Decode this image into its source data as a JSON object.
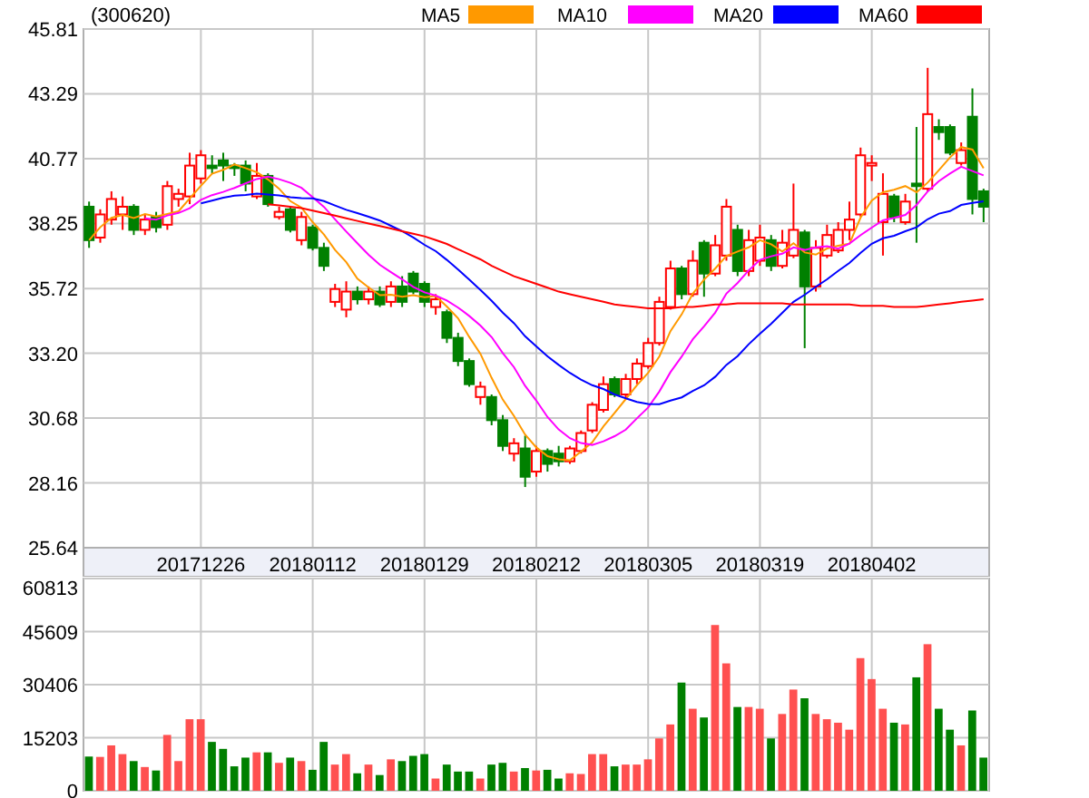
{
  "stock_code": "(300620)",
  "price_chart": {
    "chart_data": {
      "type": "candlestick",
      "grid": true,
      "legend": "top",
      "ylim": [
        25.64,
        45.81
      ],
      "yticks": [
        {
          "value": 25.64,
          "label": "25.64"
        },
        {
          "value": 28.16,
          "label": "28.16"
        },
        {
          "value": 30.68,
          "label": "30.68"
        },
        {
          "value": 33.2,
          "label": "33.20"
        },
        {
          "value": 35.72,
          "label": "35.72"
        },
        {
          "value": 38.25,
          "label": "38.25"
        },
        {
          "value": 40.77,
          "label": "40.77"
        },
        {
          "value": 43.29,
          "label": "43.29"
        },
        {
          "value": 45.81,
          "label": "45.81"
        }
      ],
      "categories": [
        null,
        null,
        null,
        null,
        null,
        null,
        null,
        null,
        null,
        null,
        "20171226",
        null,
        null,
        null,
        null,
        null,
        null,
        null,
        null,
        null,
        "20180112",
        null,
        null,
        null,
        null,
        null,
        null,
        null,
        null,
        null,
        "20180129",
        null,
        null,
        null,
        null,
        null,
        null,
        null,
        null,
        null,
        "20180212",
        null,
        null,
        null,
        null,
        null,
        null,
        null,
        null,
        null,
        "20180305",
        null,
        null,
        null,
        null,
        null,
        null,
        null,
        null,
        null,
        "20180319",
        null,
        null,
        null,
        null,
        null,
        null,
        null,
        null,
        null,
        "20180402",
        null,
        null,
        null,
        null,
        null,
        null,
        null,
        null,
        null,
        null
      ],
      "series": [
        {
          "name": "MA5",
          "type": "line",
          "color": "#ff9900",
          "values": [
            37.6,
            38.1,
            38.47,
            38.58,
            38.46,
            38.62,
            38.52,
            38.62,
            38.72,
            39.22,
            39.72,
            40.18,
            40.34,
            40.54,
            40.4,
            40.24,
            39.96,
            39.6,
            39.12,
            38.86,
            38.3,
            37.82,
            37.22,
            36.74,
            36.1,
            35.76,
            35.46,
            35.48,
            35.4,
            35.46,
            35.38,
            35.42,
            35.02,
            34.56,
            33.84,
            33.18,
            32.24,
            31.4,
            30.76,
            30.04,
            29.54,
            29.2,
            29.08,
            29.04,
            29.38,
            29.74,
            30.36,
            30.88,
            31.42,
            31.96,
            32.44,
            33.08,
            34.06,
            34.72,
            35.52,
            36.06,
            36.5,
            36.98,
            37.16,
            37.32,
            37.6,
            37.44,
            37.16,
            37.48,
            37.12,
            37.04,
            37.28,
            37.38,
            37.46,
            38.48,
            39.14,
            39.46,
            39.56,
            39.7,
            39.46,
            39.84,
            40.32,
            40.82,
            41.22,
            41.12,
            40.4
          ]
        },
        {
          "name": "MA10",
          "type": "line",
          "color": "#ff00ff",
          "values": [
            null,
            null,
            null,
            null,
            null,
            38.45,
            38.4,
            38.56,
            38.66,
            38.84,
            39.17,
            39.35,
            39.48,
            39.63,
            39.81,
            39.98,
            40.07,
            39.97,
            39.83,
            39.63,
            39.27,
            38.89,
            38.41,
            37.93,
            37.48,
            37.03,
            36.64,
            36.35,
            36.07,
            35.78,
            35.57,
            35.44,
            35.25,
            34.98,
            34.65,
            34.28,
            33.83,
            33.21,
            32.66,
            31.94,
            31.36,
            30.72,
            30.24,
            29.9,
            29.71,
            29.64,
            29.78,
            29.98,
            30.23,
            30.67,
            31.09,
            31.72,
            32.47,
            33.07,
            33.74,
            34.25,
            34.79,
            35.52,
            35.94,
            36.42,
            36.83,
            36.97,
            37.07,
            37.32,
            37.22,
            37.32,
            37.36,
            37.27,
            37.47,
            37.8,
            38.09,
            38.37,
            38.47,
            38.58,
            38.97,
            39.49,
            39.89,
            40.19,
            40.46,
            40.29,
            40.12
          ]
        },
        {
          "name": "MA20",
          "type": "line",
          "color": "#0000ff",
          "values": [
            null,
            null,
            null,
            null,
            null,
            null,
            null,
            null,
            null,
            null,
            39.03,
            39.14,
            39.25,
            39.33,
            39.36,
            39.41,
            39.38,
            39.34,
            39.27,
            39.24,
            39.22,
            39.12,
            38.95,
            38.78,
            38.65,
            38.51,
            38.36,
            38.16,
            37.95,
            37.71,
            37.42,
            37.17,
            36.83,
            36.46,
            36.07,
            35.66,
            35.24,
            34.78,
            34.37,
            33.86,
            33.47,
            33.08,
            32.75,
            32.44,
            32.18,
            31.96,
            31.81,
            31.6,
            31.45,
            31.31,
            31.23,
            31.22,
            31.36,
            31.49,
            31.73,
            31.95,
            32.29,
            32.75,
            33.09,
            33.55,
            33.96,
            34.35,
            34.77,
            35.2,
            35.48,
            35.79,
            36.08,
            36.4,
            36.71,
            37.11,
            37.46,
            37.67,
            37.77,
            37.95,
            38.1,
            38.41,
            38.63,
            38.73,
            38.97,
            39.05,
            39.11
          ]
        },
        {
          "name": "MA60",
          "type": "line",
          "color": "#ff0000",
          "values": [
            null,
            null,
            null,
            null,
            null,
            null,
            null,
            null,
            null,
            null,
            null,
            null,
            null,
            null,
            null,
            null,
            39.0,
            38.95,
            38.9,
            38.85,
            38.75,
            38.65,
            38.55,
            38.45,
            38.35,
            38.25,
            38.15,
            38.05,
            37.95,
            37.85,
            37.75,
            37.6,
            37.45,
            37.25,
            37.05,
            36.85,
            36.6,
            36.4,
            36.2,
            36.05,
            35.9,
            35.75,
            35.6,
            35.5,
            35.4,
            35.3,
            35.2,
            35.1,
            35.05,
            35.0,
            34.95,
            34.95,
            34.95,
            35.0,
            35.0,
            35.05,
            35.1,
            35.1,
            35.15,
            35.15,
            35.15,
            35.15,
            35.15,
            35.1,
            35.1,
            35.1,
            35.1,
            35.1,
            35.1,
            35.05,
            35.05,
            35.05,
            35.0,
            35.0,
            35.0,
            35.05,
            35.1,
            35.15,
            35.2,
            35.25,
            35.3
          ]
        }
      ],
      "ohlc": [
        [
          38.9,
          39.1,
          37.3,
          37.6
        ],
        [
          37.7,
          38.8,
          37.5,
          38.6
        ],
        [
          38.4,
          39.5,
          38.2,
          39.2
        ],
        [
          38.6,
          39.3,
          38.0,
          38.9
        ],
        [
          38.9,
          39.0,
          37.8,
          38.0
        ],
        [
          38.0,
          38.6,
          37.8,
          38.4
        ],
        [
          38.5,
          38.7,
          37.9,
          38.1
        ],
        [
          38.2,
          39.9,
          38.0,
          39.7
        ],
        [
          39.2,
          39.6,
          38.9,
          39.4
        ],
        [
          39.3,
          41.0,
          39.0,
          40.5
        ],
        [
          40.0,
          41.1,
          39.8,
          40.9
        ],
        [
          40.5,
          40.9,
          40.2,
          40.4
        ],
        [
          40.7,
          41.0,
          39.9,
          40.5
        ],
        [
          40.5,
          40.6,
          40.1,
          40.4
        ],
        [
          40.5,
          40.7,
          39.5,
          39.8
        ],
        [
          39.3,
          40.6,
          39.2,
          40.1
        ],
        [
          40.1,
          40.2,
          38.9,
          39.0
        ],
        [
          38.5,
          38.9,
          38.4,
          38.7
        ],
        [
          38.8,
          38.9,
          37.9,
          38.0
        ],
        [
          37.6,
          38.7,
          37.4,
          38.5
        ],
        [
          38.1,
          38.2,
          37.2,
          37.3
        ],
        [
          37.3,
          37.5,
          36.4,
          36.6
        ],
        [
          35.2,
          35.9,
          35.0,
          35.7
        ],
        [
          34.9,
          36.0,
          34.6,
          35.6
        ],
        [
          35.6,
          35.8,
          35.1,
          35.3
        ],
        [
          35.3,
          35.8,
          35.1,
          35.6
        ],
        [
          35.6,
          35.8,
          35.0,
          35.1
        ],
        [
          35.2,
          36.0,
          35.0,
          35.8
        ],
        [
          35.8,
          36.2,
          35.0,
          35.2
        ],
        [
          36.3,
          36.4,
          35.5,
          35.6
        ],
        [
          35.9,
          36.0,
          35.0,
          35.2
        ],
        [
          35.0,
          35.5,
          34.7,
          35.3
        ],
        [
          34.8,
          34.9,
          33.6,
          33.8
        ],
        [
          33.8,
          34.0,
          32.7,
          32.9
        ],
        [
          32.9,
          33.0,
          31.9,
          32.0
        ],
        [
          31.5,
          32.1,
          31.2,
          31.9
        ],
        [
          31.5,
          31.6,
          30.4,
          30.6
        ],
        [
          30.6,
          30.8,
          29.4,
          29.6
        ],
        [
          29.3,
          29.9,
          29.0,
          29.7
        ],
        [
          29.5,
          30.0,
          28.0,
          28.4
        ],
        [
          28.6,
          29.6,
          28.4,
          29.4
        ],
        [
          29.4,
          29.5,
          28.6,
          28.9
        ],
        [
          29.3,
          29.6,
          28.8,
          29.0
        ],
        [
          29.0,
          29.6,
          28.9,
          29.5
        ],
        [
          29.4,
          30.2,
          29.3,
          30.1
        ],
        [
          30.2,
          31.3,
          30.1,
          31.2
        ],
        [
          31.0,
          32.3,
          30.9,
          32.0
        ],
        [
          32.2,
          32.3,
          31.5,
          31.6
        ],
        [
          31.6,
          32.4,
          31.4,
          32.2
        ],
        [
          32.2,
          33.0,
          32.0,
          32.8
        ],
        [
          32.7,
          33.8,
          32.6,
          33.6
        ],
        [
          33.6,
          35.4,
          33.5,
          35.2
        ],
        [
          35.0,
          36.8,
          34.9,
          36.5
        ],
        [
          36.5,
          36.6,
          35.3,
          35.5
        ],
        [
          35.5,
          37.2,
          35.4,
          36.8
        ],
        [
          37.5,
          37.6,
          35.4,
          36.3
        ],
        [
          36.3,
          37.8,
          36.2,
          37.4
        ],
        [
          37.0,
          39.2,
          36.8,
          38.9
        ],
        [
          38.0,
          38.2,
          36.2,
          36.4
        ],
        [
          36.4,
          38.0,
          36.2,
          37.6
        ],
        [
          36.8,
          38.2,
          36.6,
          37.7
        ],
        [
          37.6,
          37.8,
          36.4,
          36.6
        ],
        [
          36.6,
          38.0,
          36.5,
          37.5
        ],
        [
          37.0,
          39.8,
          36.9,
          38.0
        ],
        [
          37.9,
          38.0,
          33.4,
          35.8
        ],
        [
          35.8,
          37.6,
          35.6,
          37.3
        ],
        [
          37.0,
          38.2,
          36.9,
          37.8
        ],
        [
          37.2,
          38.3,
          37.1,
          38.0
        ],
        [
          38.0,
          39.1,
          37.6,
          38.4
        ],
        [
          38.6,
          41.2,
          38.5,
          40.9
        ],
        [
          40.5,
          40.9,
          39.9,
          40.6
        ],
        [
          38.3,
          40.2,
          37.0,
          39.4
        ],
        [
          39.3,
          39.4,
          38.3,
          38.5
        ],
        [
          38.3,
          39.4,
          38.2,
          39.1
        ],
        [
          39.8,
          42.0,
          37.5,
          39.7
        ],
        [
          39.6,
          44.3,
          39.5,
          42.5
        ],
        [
          42.0,
          42.3,
          41.5,
          41.8
        ],
        [
          42.0,
          42.1,
          40.9,
          41.0
        ],
        [
          40.6,
          41.4,
          40.5,
          41.1
        ],
        [
          42.4,
          43.5,
          38.6,
          39.2
        ],
        [
          39.5,
          39.6,
          38.3,
          38.9
        ]
      ]
    }
  },
  "volume_chart": {
    "chart_data": {
      "type": "bar",
      "grid": true,
      "ylim": [
        0,
        60813
      ],
      "yticks": [
        {
          "value": 0,
          "label": "0"
        },
        {
          "value": 15203,
          "label": "15203"
        },
        {
          "value": 30406,
          "label": "30406"
        },
        {
          "value": 45609,
          "label": "45609"
        },
        {
          "value": 60813,
          "label": "60813"
        }
      ],
      "values": [
        9800,
        9700,
        13000,
        10500,
        8500,
        6800,
        5800,
        16000,
        8500,
        20500,
        20500,
        14000,
        12000,
        7000,
        9500,
        11000,
        11000,
        8000,
        9500,
        8500,
        6000,
        14000,
        7500,
        10500,
        5000,
        7500,
        4500,
        9000,
        8500,
        10000,
        10500,
        3500,
        7500,
        5500,
        5500,
        3500,
        7500,
        8000,
        5500,
        6500,
        5800,
        6000,
        3500,
        5000,
        4800,
        10500,
        10500,
        7000,
        7500,
        7500,
        9000,
        15000,
        19000,
        31000,
        23500,
        21000,
        47500,
        36500,
        24000,
        24000,
        23500,
        15000,
        22000,
        29000,
        26500,
        22000,
        20500,
        19500,
        17500,
        38000,
        32000,
        23500,
        19500,
        19000,
        32500,
        42000,
        23500,
        17500,
        13000,
        23000,
        9500
      ]
    }
  }
}
